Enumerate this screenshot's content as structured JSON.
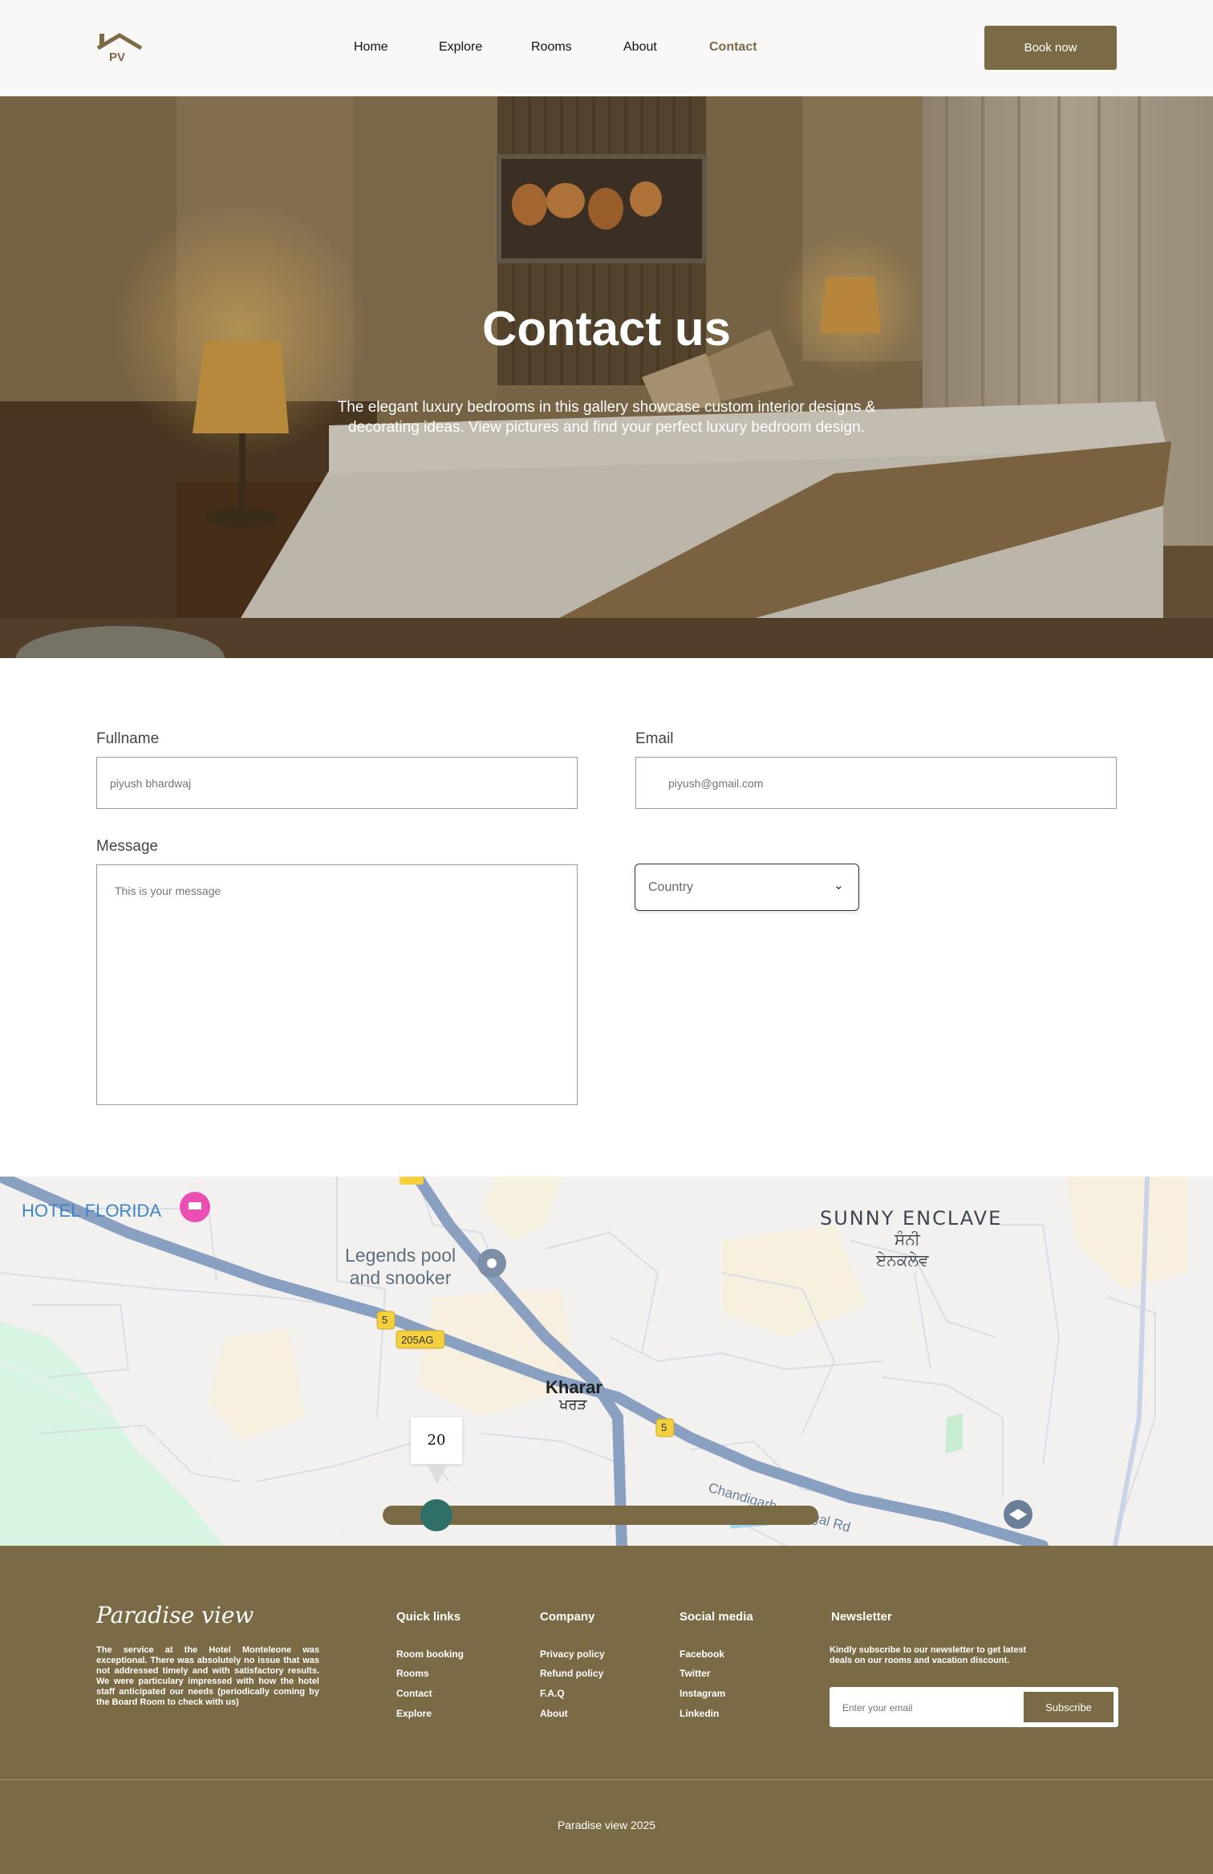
{
  "header": {
    "logo_text": "PV",
    "nav": [
      "Home",
      "Explore",
      "Rooms",
      "About",
      "Contact"
    ],
    "active_nav": "Contact",
    "book_label": "Book now"
  },
  "hero": {
    "title": "Contact us",
    "subtitle": "The elegant luxury bedrooms in this gallery showcase custom interior designs & decorating ideas. View pictures and find your perfect luxury bedroom design."
  },
  "form": {
    "fullname_label": "Fullname",
    "fullname_placeholder": "piyush bhardwaj",
    "email_label": "Email",
    "email_placeholder": "piyush@gmail.com",
    "message_label": "Message",
    "message_placeholder": "This is your message",
    "country_selected": "Country"
  },
  "map": {
    "labels": {
      "hotel": "HOTEL FLORIDA",
      "pool_line1": "Legends pool",
      "pool_line2": "and snooker",
      "enclave": "SUNNY ENCLAVE",
      "enclave_pa1": "ਸੰਨੀ",
      "enclave_pa2": "ਏਨਕਲੇਵ",
      "kharar": "Kharar",
      "kharar_pa": "ਖਰੜ",
      "road": "Chandigarh - Nangal Rd",
      "shield_5a": "5",
      "shield_5b": "5",
      "shield_205": "205AG"
    },
    "slider_value": "20"
  },
  "footer": {
    "brand": "Paradise view",
    "description": "The service at the Hotel Monteleone was exceptional. There was absolutely no issue that was not addressed timely and with satisfactory results. We were particulary impressed with how the hotel staff anticipated our needs (periodically coming by the Board Room to check with us)",
    "quick_links": {
      "title": "Quick links",
      "items": [
        "Room booking",
        "Rooms",
        "Contact",
        "Explore"
      ]
    },
    "company": {
      "title": "Company",
      "items": [
        "Privacy policy",
        "Refund policy",
        "F.A.Q",
        "About"
      ]
    },
    "social": {
      "title": "Social media",
      "items": [
        "Facebook",
        "Twitter",
        "Instagram",
        "Linkedin"
      ]
    },
    "newsletter": {
      "title": "Newsletter",
      "description": "Kindly subscribe to our newsletter to get latest deals on our rooms and vacation discount.",
      "placeholder": "Enter your email",
      "button": "Subscribe"
    },
    "copyright": "Paradise view 2025"
  },
  "colors": {
    "brand": "#7b6a46",
    "slider_thumb": "#2e7068",
    "road": "#8aa0c0"
  }
}
